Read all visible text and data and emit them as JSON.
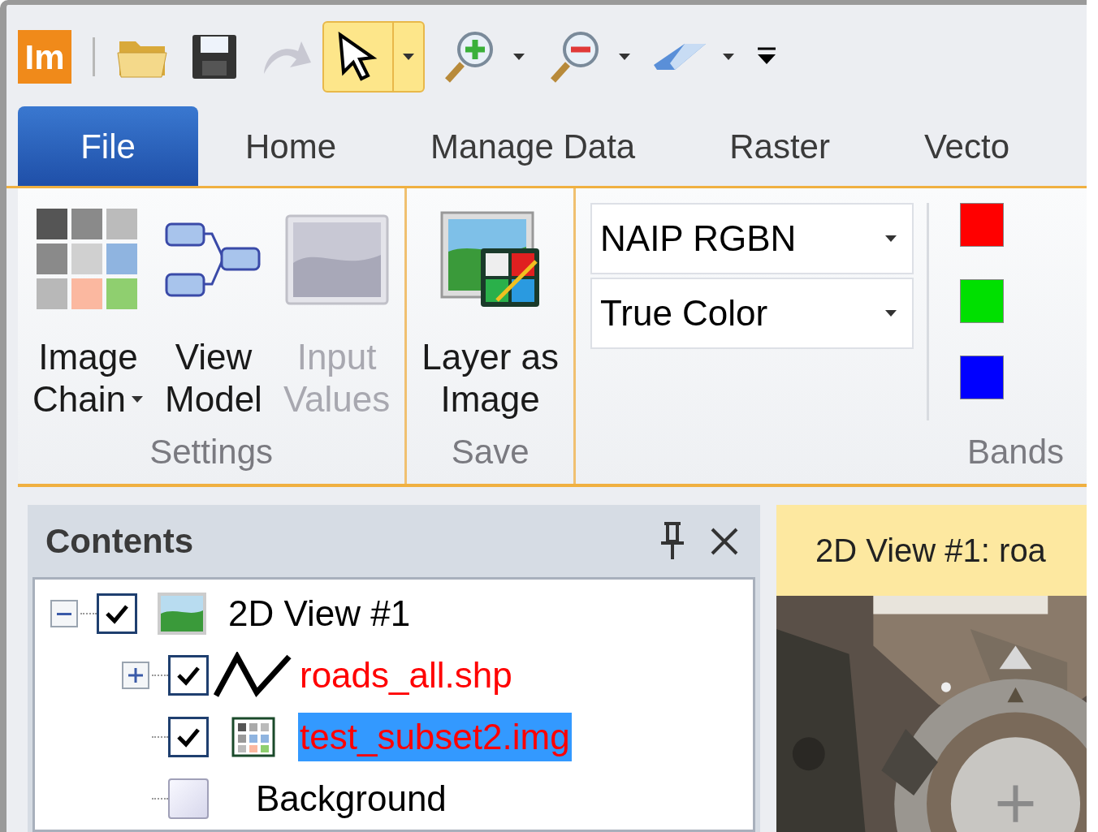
{
  "app_logo": "Im",
  "tabs": [
    {
      "label": "File",
      "selected": true,
      "kind": "backstage"
    },
    {
      "label": "Home",
      "selected": false,
      "kind": "tab"
    },
    {
      "label": "Manage Data",
      "selected": false,
      "kind": "tab"
    },
    {
      "label": "Raster",
      "selected": false,
      "kind": "tab"
    },
    {
      "label": "Vecto",
      "selected": false,
      "kind": "tab"
    }
  ],
  "ribbon": {
    "groups": [
      {
        "label": "Settings",
        "buttons": [
          {
            "kind": "grid",
            "lines": [
              "Image",
              "Chain"
            ],
            "dropdown": true,
            "disabled": false
          },
          {
            "kind": "model",
            "lines": [
              "View",
              "Model"
            ],
            "dropdown": false,
            "disabled": false
          },
          {
            "lines": [
              "Input",
              "Values"
            ],
            "dropdown": false,
            "disabled": true
          }
        ]
      },
      {
        "label": "Save",
        "buttons": [
          {
            "kind": "layer",
            "lines": [
              "Layer as",
              "Image"
            ],
            "dropdown": false,
            "disabled": false
          }
        ]
      },
      {
        "label": "Bands",
        "dropdowns": [
          {
            "value": "NAIP RGBN"
          },
          {
            "value": "True Color"
          }
        ],
        "bands": [
          {
            "color": "#ff0000"
          },
          {
            "color": "#00e000"
          },
          {
            "color": "#0000ff"
          }
        ]
      }
    ]
  },
  "contents": {
    "title": "Contents",
    "tree": [
      {
        "label": "2D View #1",
        "kind": "view",
        "checked": true,
        "expanded": true,
        "selected": false,
        "color": "#000000",
        "children": [
          {
            "label": "roads_all.shp",
            "kind": "vector",
            "checked": true,
            "expanded": false,
            "selected": false,
            "color": "#ff0000"
          },
          {
            "label": "test_subset2.img",
            "kind": "raster",
            "checked": true,
            "selected": true,
            "color": "#ff0000"
          },
          {
            "label": "Background",
            "kind": "background",
            "checked": false,
            "selected": false,
            "color": "#000000"
          }
        ]
      }
    ]
  },
  "view": {
    "title": "2D View #1: roa"
  }
}
